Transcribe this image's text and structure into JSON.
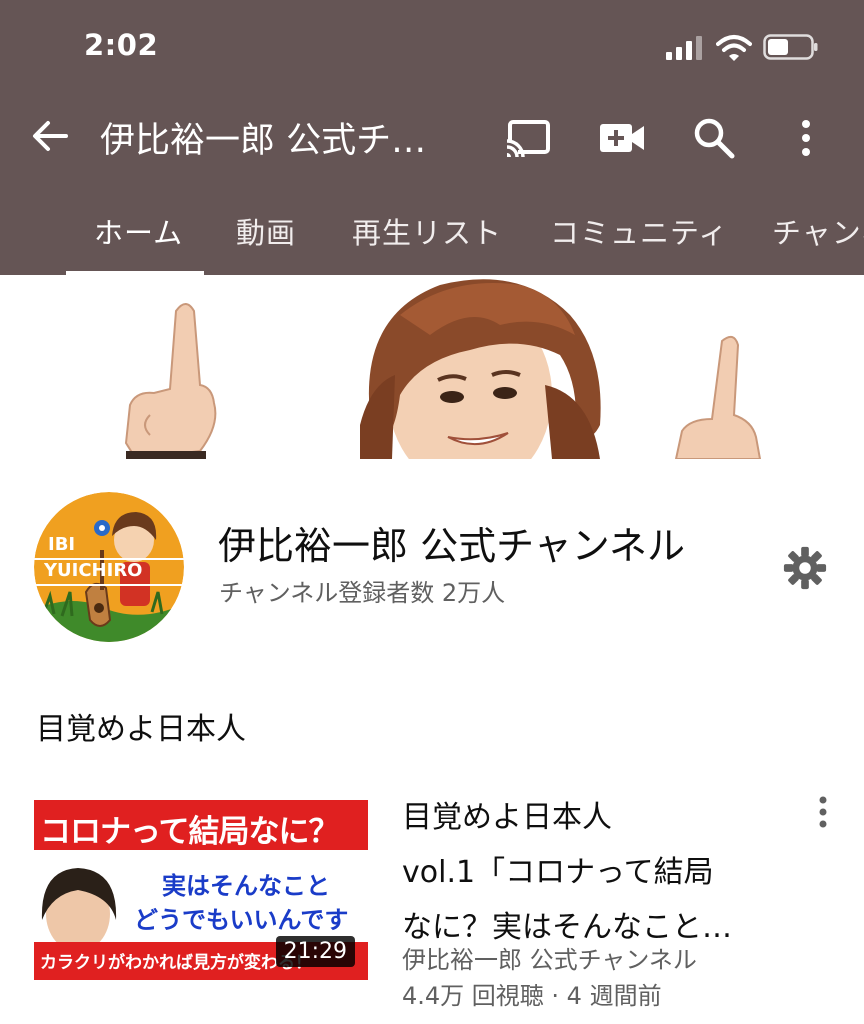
{
  "status_bar": {
    "time": "2:02"
  },
  "header": {
    "title": "伊比裕一郎 公式チ…",
    "icons": [
      "back-arrow-icon",
      "cast-icon",
      "video-camera-add-icon",
      "search-icon",
      "more-vert-icon"
    ]
  },
  "tabs": [
    {
      "label": "ホーム",
      "selected": true
    },
    {
      "label": "動画",
      "selected": false
    },
    {
      "label": "再生リスト",
      "selected": false
    },
    {
      "label": "コミュニティ",
      "selected": false
    },
    {
      "label": "チャンネル",
      "selected": false
    }
  ],
  "channel": {
    "avatar_text_line1": "IBI",
    "avatar_text_line2": "YUICHIRO",
    "name": "伊比裕一郎 公式チャンネル",
    "subscribers": "チャンネル登録者数 2万人"
  },
  "section": {
    "title": "目覚めよ日本人"
  },
  "video": {
    "thumb_line1": "コロナって結局なに？",
    "thumb_line2": "実はそんなこと",
    "thumb_line3": "どうでもいいんです",
    "thumb_line4": "カラクリがわかれば見方が変わる！",
    "duration": "21:29",
    "title": "目覚めよ日本人\nvol.1「コロナって結局\nなに？実はそんなこと…",
    "channel": "伊比裕一郎 公式チャンネル",
    "views_age": "4.4万 回視聴 · 4 週間前"
  },
  "colors": {
    "appbar": "#655555",
    "thumb_red": "#e02020",
    "thumb_blue": "#1a3cc8",
    "avatar_orange": "#f0a020"
  }
}
